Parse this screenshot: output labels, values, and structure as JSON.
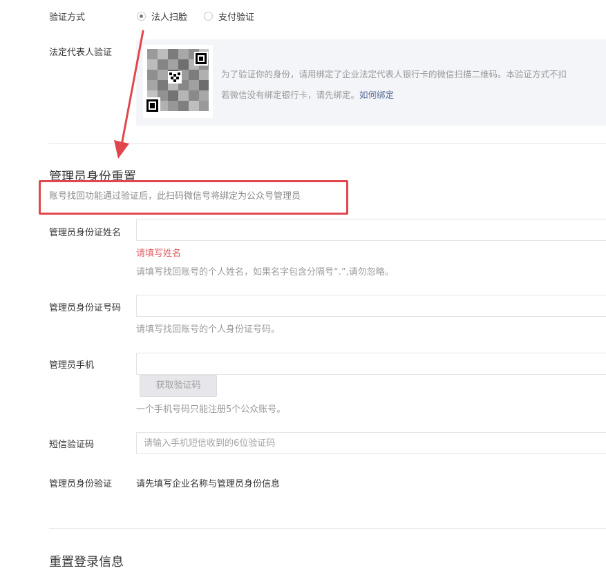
{
  "verification": {
    "label": "验证方式",
    "options": [
      {
        "label": "法人扫脸",
        "selected": true
      },
      {
        "label": "支付验证",
        "selected": false
      }
    ]
  },
  "legal_rep": {
    "label": "法定代表人验证",
    "hint_line1": "为了验证你的身份，请用绑定了企业法定代表人银行卡的微信扫描二维码。本验证方式不扣",
    "hint_line2_prefix": "若微信没有绑定银行卡，请先绑定。",
    "hint_link": "如何绑定"
  },
  "admin_reset": {
    "title": "管理员身份重置",
    "description": "账号找回功能通过验证后，此扫码微信号将绑定为公众号管理员"
  },
  "fields": {
    "name": {
      "label": "管理员身份证姓名",
      "value": "",
      "error": "请填写姓名",
      "hint": "请填写找回账号的个人姓名，如果名字包含分隔号“.”,请勿忽略。"
    },
    "id_number": {
      "label": "管理员身份证号码",
      "value": "",
      "hint": "请填写找回账号的个人身份证号码。"
    },
    "phone": {
      "label": "管理员手机",
      "value": "",
      "button": "获取验证码",
      "hint": "一个手机号码只能注册5个公众账号。"
    },
    "sms": {
      "label": "短信验证码",
      "placeholder": "请输入手机短信收到的6位验证码"
    },
    "identity": {
      "label": "管理员身份验证",
      "value": "请先填写企业名称与管理员身份信息"
    }
  },
  "reset_login": {
    "title": "重置登录信息"
  },
  "colors": {
    "annotation_red": "#e0474c",
    "link": "#576b95",
    "error": "#e15f63"
  }
}
